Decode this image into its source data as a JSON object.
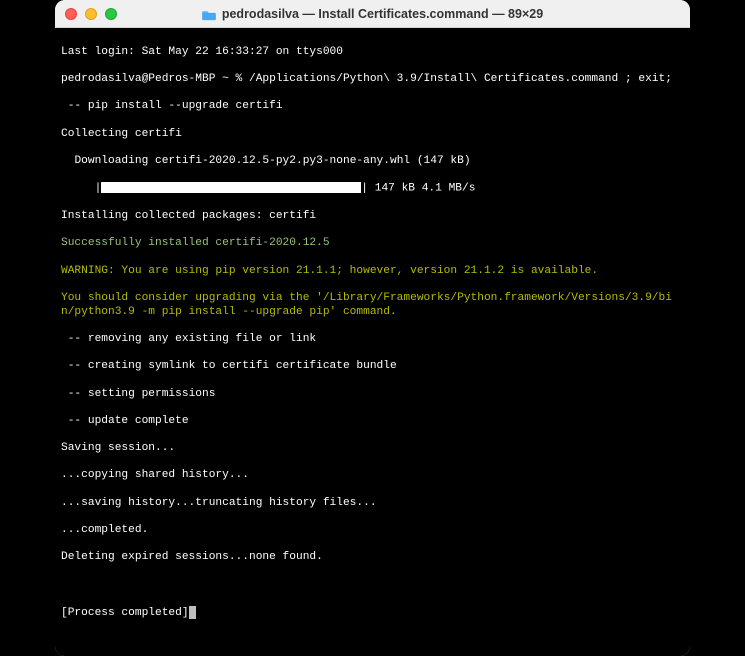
{
  "titlebar": {
    "title": "pedrodasilva — Install Certificates.command — 89×29",
    "folder_icon": "folder-icon"
  },
  "terminal": {
    "last_login": "Last login: Sat May 22 16:33:27 on ttys000",
    "prompt_line": "pedrodasilva@Pedros-MBP ~ % /Applications/Python\\ 3.9/Install\\ Certificates.command ; exit;",
    "pip_install": " -- pip install --upgrade certifi",
    "collecting": "Collecting certifi",
    "downloading": "  Downloading certifi-2020.12.5-py2.py3-none-any.whl (147 kB)",
    "progress_prefix": "     |",
    "progress_suffix": "| 147 kB 4.1 MB/s",
    "installing": "Installing collected packages: certifi",
    "success": "Successfully installed certifi-2020.12.5",
    "warning1": "WARNING: You are using pip version 21.1.1; however, version 21.1.2 is available.",
    "warning2": "You should consider upgrading via the '/Library/Frameworks/Python.framework/Versions/3.9/bin/python3.9 -m pip install --upgrade pip' command.",
    "removing": " -- removing any existing file or link",
    "creating": " -- creating symlink to certifi certificate bundle",
    "setting": " -- setting permissions",
    "update": " -- update complete",
    "saving_session": "Saving session...",
    "copying": "...copying shared history...",
    "saving_hist": "...saving history...truncating history files...",
    "completed": "...completed.",
    "deleting": "Deleting expired sessions...none found.",
    "blank": " ",
    "process": "[Process completed]"
  }
}
